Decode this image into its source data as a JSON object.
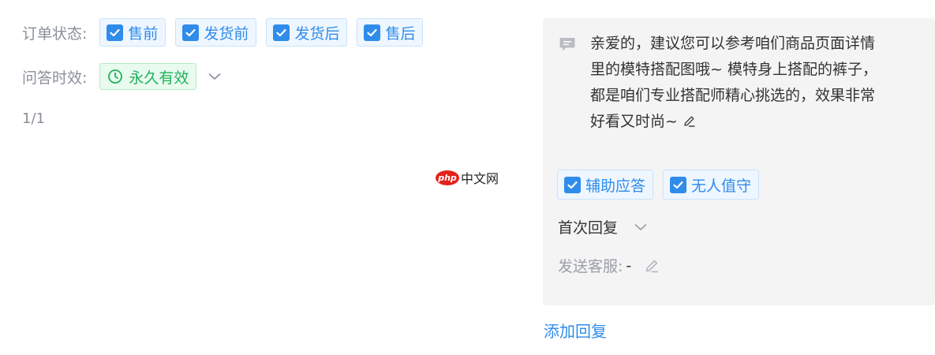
{
  "filters": {
    "order_status": {
      "label": "订单状态:",
      "options": [
        "售前",
        "发货前",
        "发货后",
        "售后"
      ]
    },
    "qa_validity": {
      "label": "问答时效:",
      "value": "永久有效"
    }
  },
  "pagination": {
    "text": "1/1"
  },
  "watermark": {
    "logo": "php",
    "text": "中文网"
  },
  "reply_card": {
    "message": "亲爱的，建议您可以参考咱们商品页面详情里的模特搭配图哦~ 模特身上搭配的裤子，都是咱们专业搭配师精心挑选的，效果非常好看又时尚~",
    "tags": [
      "辅助应答",
      "无人值守"
    ],
    "reply_type": "首次回复",
    "send_agent_label": "发送客服:",
    "send_agent_value": "-"
  },
  "add_reply_label": "添加回复",
  "colors": {
    "accent": "#2f8cea",
    "green": "#1fb35a",
    "card_bg": "#f4f4f4",
    "label_gray": "#8a8f99"
  }
}
